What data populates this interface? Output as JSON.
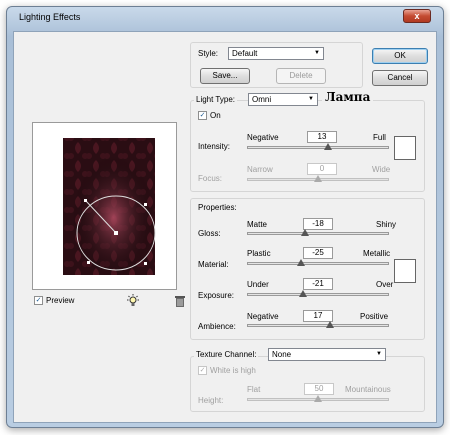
{
  "window": {
    "title": "Lighting Effects",
    "close_glyph": "x"
  },
  "style_row": {
    "label": "Style:",
    "value": "Default",
    "save": "Save...",
    "delete": "Delete"
  },
  "buttons": {
    "ok": "OK",
    "cancel": "Cancel"
  },
  "preview": {
    "label": "Preview",
    "checked": true
  },
  "light": {
    "type_label": "Light Type:",
    "type_value": "Omni",
    "annotation": "Лампа",
    "on_label": "On",
    "on_checked": true,
    "intensity": {
      "label": "Intensity:",
      "min_label": "Negative",
      "max_label": "Full",
      "value": "13",
      "level": 0.57
    },
    "focus": {
      "label": "Focus:",
      "min_label": "Narrow",
      "max_label": "Wide",
      "value": "0",
      "level": 0.5
    }
  },
  "properties": {
    "title": "Properties:",
    "gloss": {
      "label": "Gloss:",
      "min_label": "Matte",
      "max_label": "Shiny",
      "value": "-18",
      "level": 0.41
    },
    "material": {
      "label": "Material:",
      "min_label": "Plastic",
      "max_label": "Metallic",
      "value": "-25",
      "level": 0.375
    },
    "exposure": {
      "label": "Exposure:",
      "min_label": "Under",
      "max_label": "Over",
      "value": "-21",
      "level": 0.395
    },
    "ambience": {
      "label": "Ambience:",
      "min_label": "Negative",
      "max_label": "Positive",
      "value": "17",
      "level": 0.585
    }
  },
  "texture": {
    "channel_label": "Texture Channel:",
    "channel_value": "None",
    "white_high_label": "White is high",
    "white_high_checked": true,
    "height": {
      "label": "Height:",
      "min_label": "Flat",
      "max_label": "Mountainous",
      "value": "50",
      "level": 0.5
    }
  },
  "icons": {
    "checkmark": "✓",
    "dropdown": "▼"
  },
  "colors": {
    "accent": "#3c7fb1",
    "close": "#c44b32",
    "preview_tint": "#5a1e28"
  }
}
